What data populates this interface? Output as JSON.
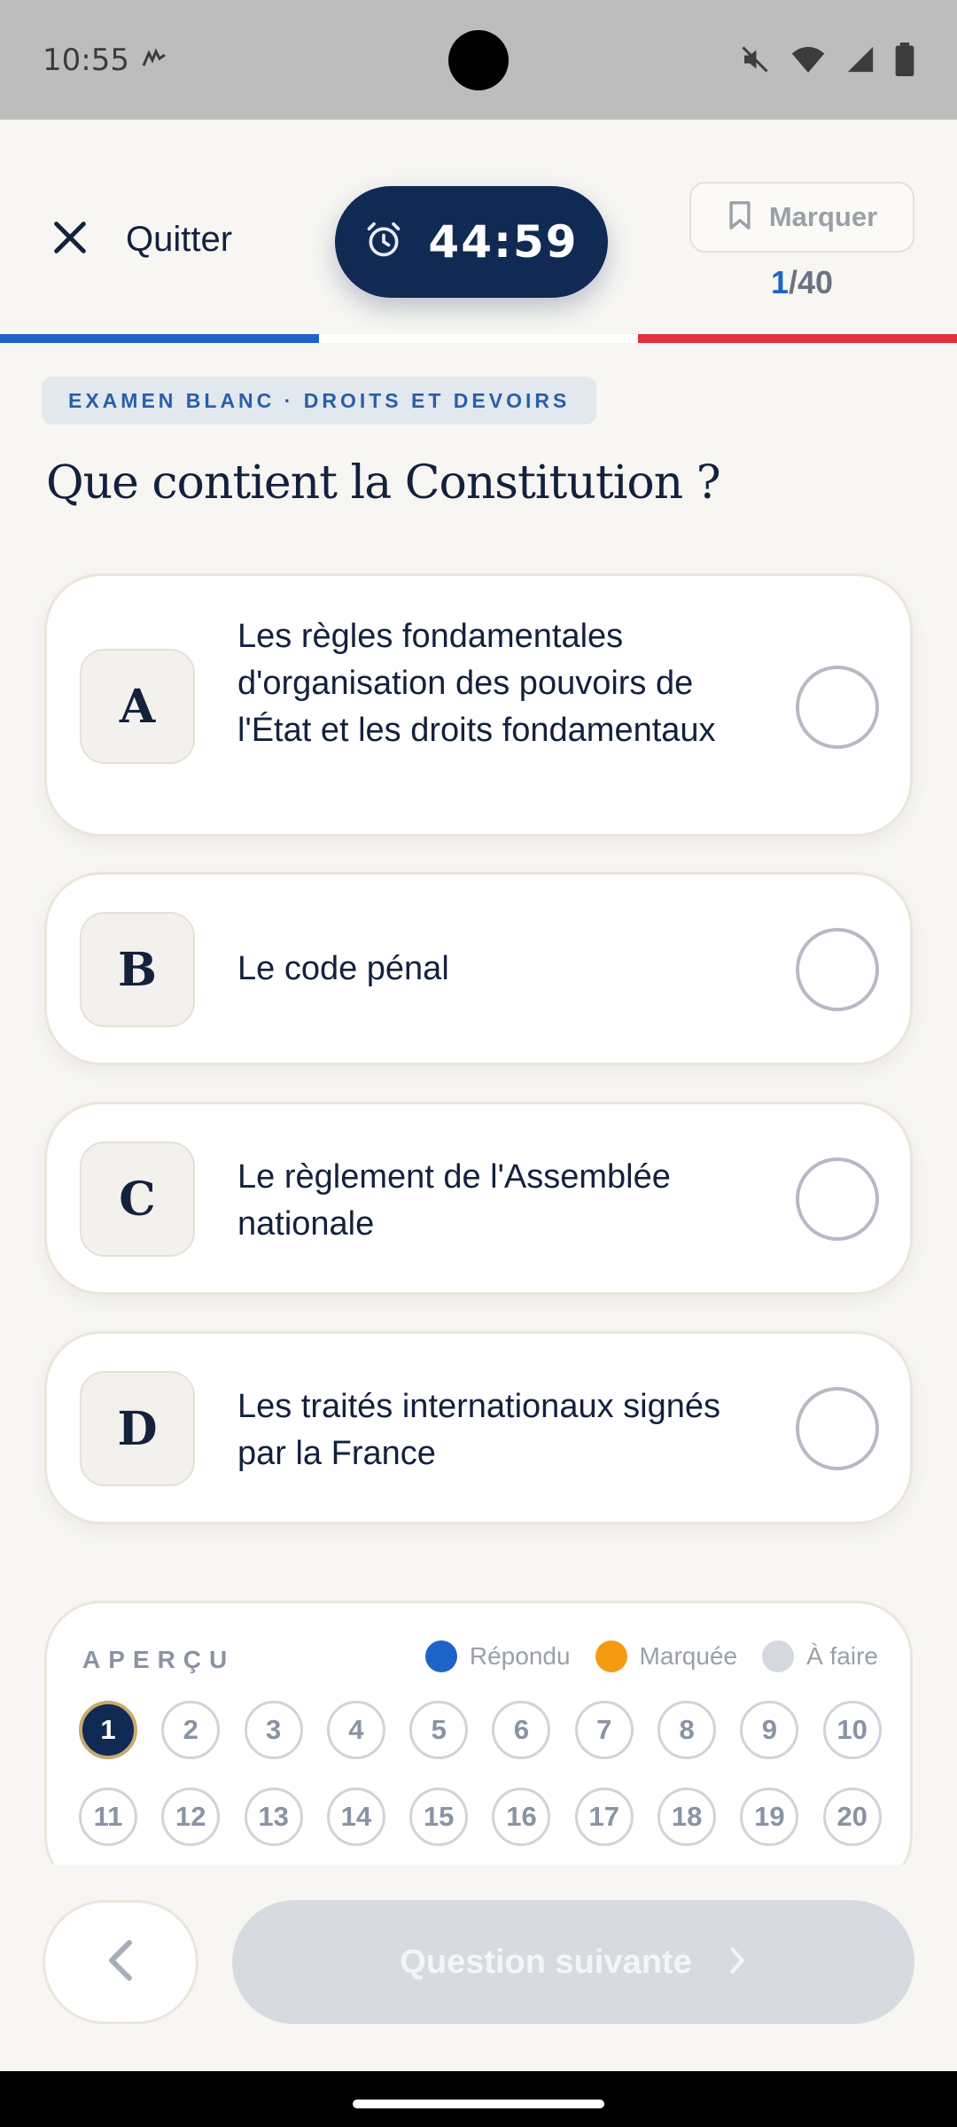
{
  "status_bar": {
    "time": "10:55",
    "icons": [
      "mute-icon",
      "wifi-icon",
      "signal-icon",
      "battery-icon"
    ]
  },
  "header": {
    "quit_label": "Quitter",
    "timer": "44:59",
    "mark_label": "Marquer",
    "counter_current": "1",
    "counter_total": "/40"
  },
  "colors": {
    "navy": "#112a54",
    "blue": "#1e64c8",
    "red": "#e2303c",
    "orange": "#f39c12",
    "gray": "#d5d8de"
  },
  "badge": "EXAMEN BLANC · DROITS ET DEVOIRS",
  "question": "Que contient la Constitution ?",
  "options": [
    {
      "letter": "A",
      "text": "Les règles fondamentales d'organisation des pouvoirs de l'État et les droits fondamentaux"
    },
    {
      "letter": "B",
      "text": "Le code pénal"
    },
    {
      "letter": "C",
      "text": "Le règlement de l'Assemblée nationale"
    },
    {
      "letter": "D",
      "text": "Les traités internationaux signés par la France"
    }
  ],
  "overview": {
    "title": "APERÇU",
    "legend": [
      {
        "label": "Répondu",
        "color": "#1e64c8"
      },
      {
        "label": "Marquée",
        "color": "#f39c12"
      },
      {
        "label": "À faire",
        "color": "#d5d8de"
      }
    ],
    "numbers": [
      "1",
      "2",
      "3",
      "4",
      "5",
      "6",
      "7",
      "8",
      "9",
      "10",
      "11",
      "12",
      "13",
      "14",
      "15",
      "16",
      "17",
      "18",
      "19",
      "20"
    ],
    "current": "1"
  },
  "footer": {
    "next_label": "Question suivante"
  }
}
